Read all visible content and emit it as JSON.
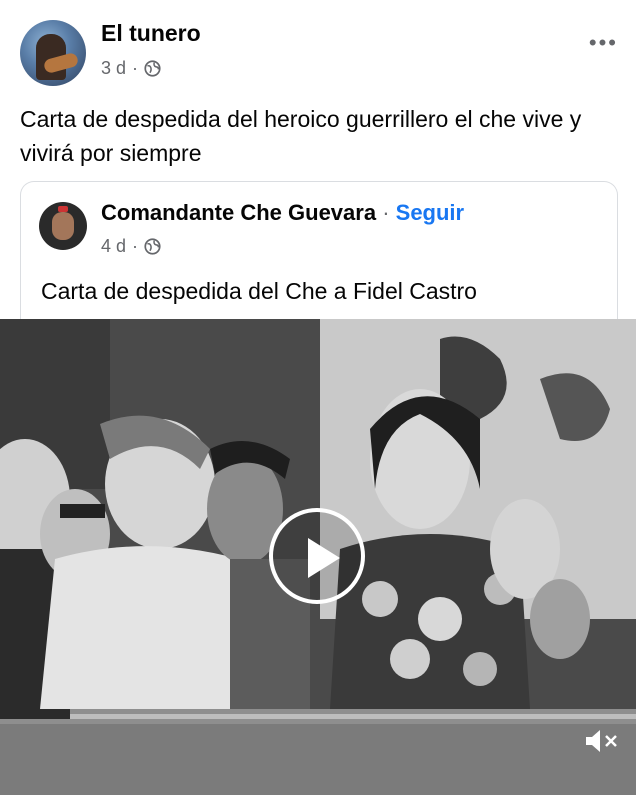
{
  "post": {
    "author": "El tunero",
    "time": "3 d",
    "more_icon": "more-horizontal-icon",
    "text": "Carta de despedida del heroico guerrillero el che vive y vivirá por siempre"
  },
  "shared_post": {
    "author": "Comandante Che Guevara",
    "separator": " · ",
    "follow_label": "Seguir",
    "time": "4 d",
    "text": "Carta de despedida del Che a Fidel Castro"
  },
  "video": {
    "play_icon": "play-icon",
    "mute_icon": "volume-muted-icon"
  },
  "colors": {
    "link": "#1877f2",
    "meta": "#65676b",
    "text": "#050505"
  }
}
